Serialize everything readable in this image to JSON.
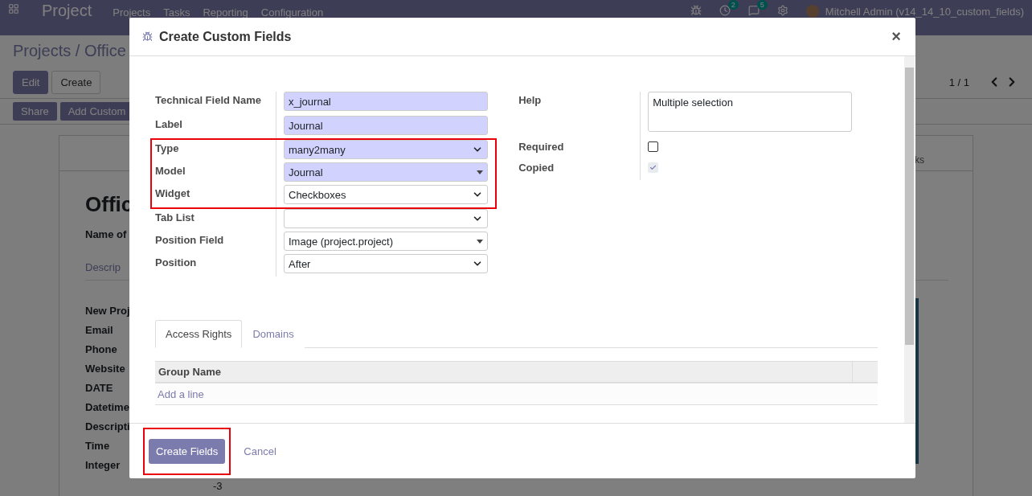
{
  "navbar": {
    "app_title": "Project",
    "menu": [
      "Projects",
      "Tasks",
      "Reporting",
      "Configuration"
    ],
    "systray": [
      {
        "kind": "bug"
      },
      {
        "kind": "activity",
        "badge": "2"
      },
      {
        "kind": "chat",
        "badge": "5"
      },
      {
        "kind": "gear"
      }
    ],
    "user": "Mitchell Admin (v14_14_10_custom_fields)"
  },
  "background": {
    "breadcrumb": "Projects / Office",
    "buttons": [
      {
        "label": "Edit",
        "primary": true
      },
      {
        "label": "Create",
        "primary": false
      }
    ],
    "actions": [
      "Share",
      "Add Custom"
    ],
    "pager": "1 / 1",
    "sheet_tab": "ks",
    "title": "Offic",
    "subtitle": "Name of",
    "notebook_tab": "Descrip",
    "labels": [
      "New Proj",
      "Email",
      "Phone",
      "Website",
      "DATE",
      "Datetime",
      "Descripti",
      "Time",
      "Integer"
    ],
    "integer_value": "-3"
  },
  "dialog": {
    "title": "Create Custom Fields",
    "close": "×",
    "left_fields": [
      {
        "label": "Technical Field Name",
        "value": "x_journal",
        "kind": "text",
        "required": true,
        "outlined": false
      },
      {
        "label": "Label",
        "value": "Journal",
        "kind": "text",
        "required": true,
        "outlined": false
      },
      {
        "label": "Type",
        "value": "many2many",
        "kind": "select",
        "required": true,
        "outlined": true
      },
      {
        "label": "Model",
        "value": "Journal",
        "kind": "many2one",
        "required": true,
        "outlined": true
      },
      {
        "label": "Widget",
        "value": "Checkboxes",
        "kind": "select",
        "required": false,
        "outlined": true
      },
      {
        "label": "Tab List",
        "kind": "select",
        "required": false,
        "outlined": false
      },
      {
        "label": "Position Field",
        "value": "Image (project.project)",
        "kind": "many2one",
        "required": false,
        "outlined": false
      },
      {
        "label": "Position",
        "value": "After",
        "kind": "select",
        "required": false,
        "outlined": false
      }
    ],
    "help": {
      "label": "Help",
      "value": "Multiple selection"
    },
    "checkboxes": [
      {
        "label": "Required",
        "checked": false,
        "disabled": false
      },
      {
        "label": "Copied",
        "checked": true,
        "disabled": true
      }
    ],
    "tabs": [
      {
        "label": "Access Rights",
        "selected": true
      },
      {
        "label": "Domains",
        "selected": false
      }
    ],
    "table": {
      "columns": [
        "Group Name"
      ],
      "add_line": "Add a line"
    },
    "footer": {
      "primary": {
        "label": "Create Fields",
        "outlined": true
      },
      "cancel": "Cancel"
    }
  }
}
